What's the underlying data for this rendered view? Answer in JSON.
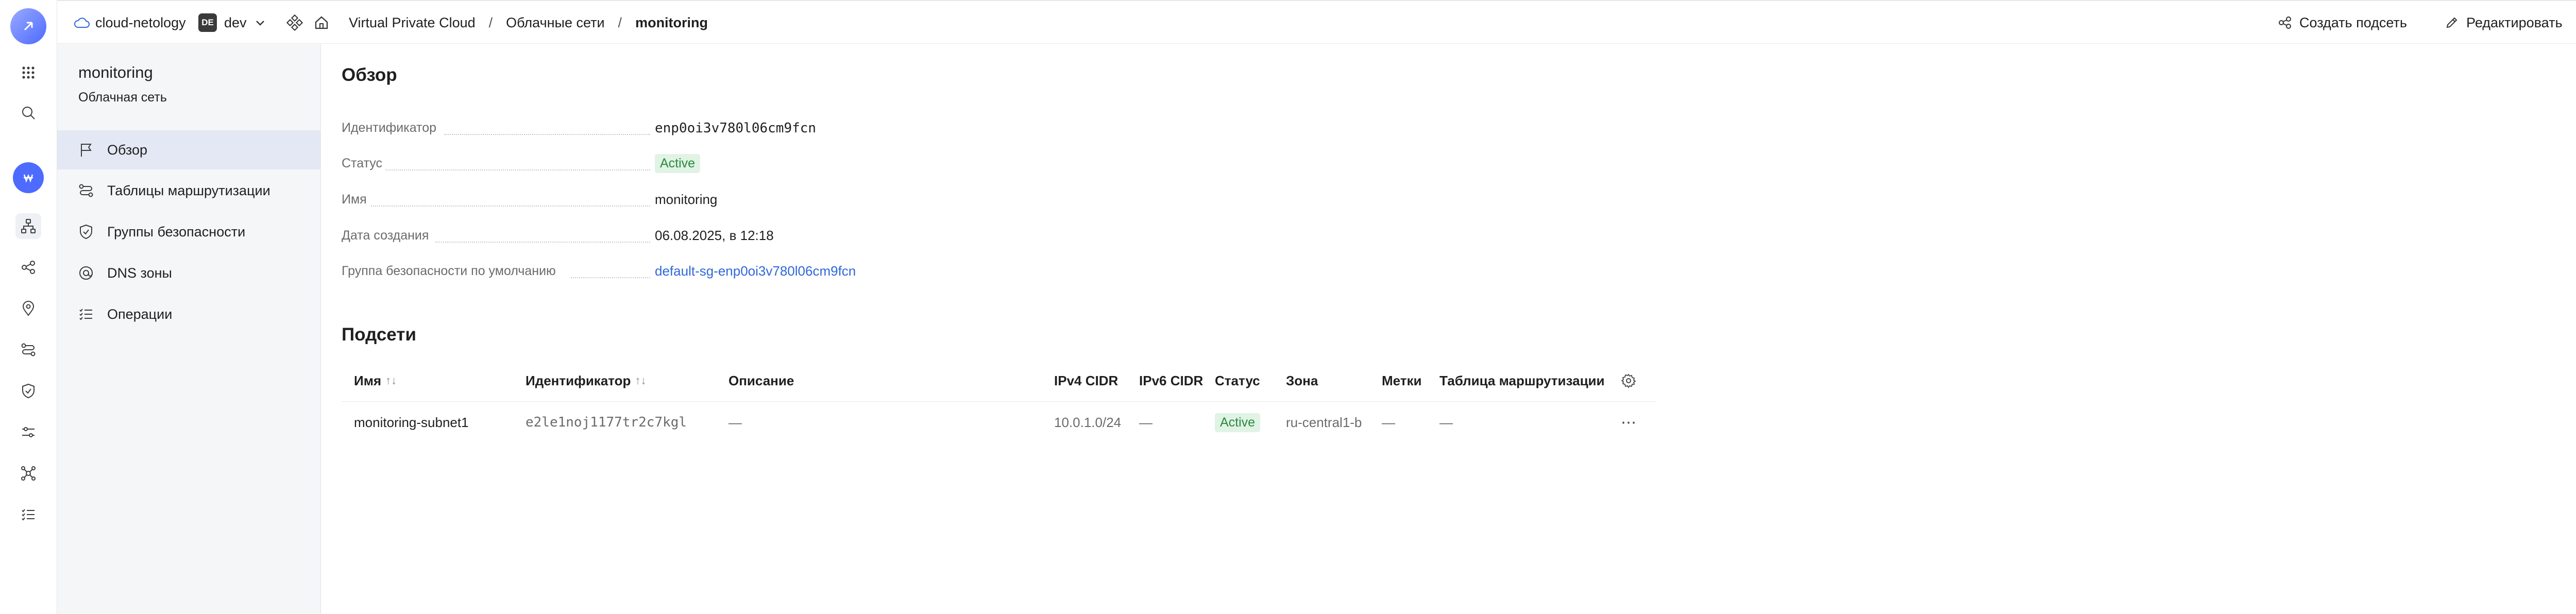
{
  "header": {
    "cloud_name": "cloud-netology",
    "folder_badge": "DE",
    "folder_name": "dev",
    "breadcrumbs": [
      "Virtual Private Cloud",
      "Облачные сети",
      "monitoring"
    ],
    "separator": "/",
    "actions": {
      "create_subnet": "Создать подсеть",
      "edit": "Редактировать",
      "more": "⋯"
    }
  },
  "sidebar": {
    "title": "monitoring",
    "subtitle": "Облачная сеть",
    "items": [
      {
        "label": "Обзор",
        "icon": "flag-icon",
        "active": true
      },
      {
        "label": "Таблицы маршрутизации",
        "icon": "route-icon",
        "active": false
      },
      {
        "label": "Группы безопасности",
        "icon": "shield-icon",
        "active": false
      },
      {
        "label": "DNS зоны",
        "icon": "dns-icon",
        "active": false
      },
      {
        "label": "Операции",
        "icon": "list-icon",
        "active": false
      }
    ]
  },
  "overview": {
    "title": "Обзор",
    "properties": [
      {
        "label": "Идентификатор",
        "value": "enp0oi3v780l06cm9fcn"
      },
      {
        "label": "Статус",
        "value": "Active"
      },
      {
        "label": "Имя",
        "value": "monitoring"
      },
      {
        "label": "Дата создания",
        "value": "06.08.2025, в 12:18"
      },
      {
        "label": "Группа безопасности по умолчанию",
        "value": "default-sg-enp0oi3v780l06cm9fcn"
      }
    ]
  },
  "subnets": {
    "title": "Подсети",
    "columns": [
      "Имя",
      "Идентификатор",
      "Описание",
      "IPv4 CIDR",
      "IPv6 CIDR",
      "Статус",
      "Зона",
      "Метки",
      "Таблица маршрутизации"
    ],
    "sort_glyph": "↑↓",
    "rows": [
      {
        "name": "monitoring-subnet1",
        "id": "e2le1noj1177tr2c7kgl",
        "description": "—",
        "ipv4": "10.0.1.0/24",
        "ipv6": "—",
        "status": "Active",
        "zone": "ru-central1-b",
        "labels": "—",
        "route_table": "—",
        "menu": "⋯"
      }
    ]
  },
  "colors": {
    "accent": "#4d6bff",
    "active_bg": "#e0f3e4",
    "active_text": "#2a8a3f",
    "link": "#2f68d8",
    "panel_bg": "#f5f6f8",
    "nav_active_bg": "#e4e8f4"
  }
}
